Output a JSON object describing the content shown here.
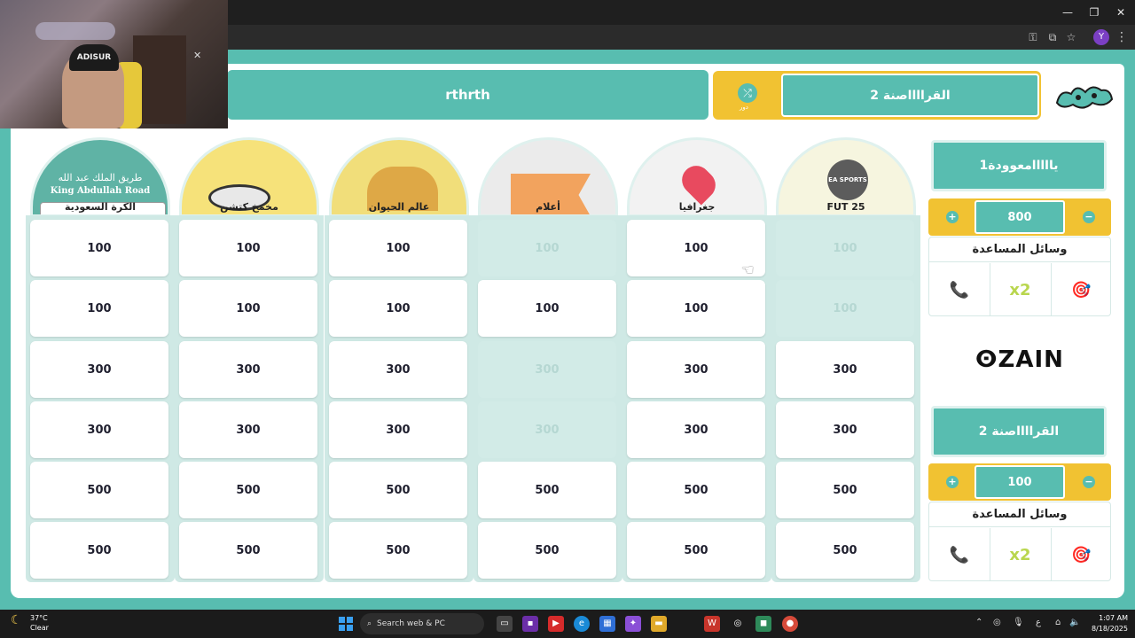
{
  "window": {
    "minimize": "—",
    "maximize": "❐",
    "close": "✕"
  },
  "browser": {
    "profile_initial": "Y",
    "menu": "⋮"
  },
  "webcam": {
    "hat_text": "ADISUR"
  },
  "header": {
    "team_left": "rthrth",
    "team_right": "القرااااصنة 2",
    "turn_label": "دور"
  },
  "categories": [
    {
      "label": "FUT 25",
      "badge": "EA SPORTS",
      "bg": "#f6f5df"
    },
    {
      "label": "جغرافيا",
      "bg": "#f2f2f2"
    },
    {
      "label": "أعلام",
      "bg": "#ebebeb"
    },
    {
      "label": "عالم الحيوان",
      "bg": "#f1de7a"
    },
    {
      "label": "مخمخ كتشن",
      "bg": "#f6e27a"
    },
    {
      "label": "الكرة السعودية",
      "sign_ar": "طريق الملك عبد الله",
      "sign_en": "King Abdullah Road",
      "bg": "#5fb3a5"
    }
  ],
  "grid": {
    "rows": [
      [
        "100",
        "100",
        "100",
        "100",
        "100",
        "100"
      ],
      [
        "100",
        "100",
        "100",
        "100",
        "100",
        "100"
      ],
      [
        "300",
        "300",
        "300",
        "300",
        "300",
        "300"
      ],
      [
        "300",
        "300",
        "300",
        "300",
        "300",
        "300"
      ],
      [
        "500",
        "500",
        "500",
        "500",
        "500",
        "500"
      ],
      [
        "500",
        "500",
        "500",
        "500",
        "500",
        "500"
      ]
    ],
    "used": [
      [
        true,
        false,
        true,
        false,
        false,
        false
      ],
      [
        true,
        false,
        false,
        false,
        false,
        false
      ],
      [
        false,
        false,
        true,
        false,
        false,
        false
      ],
      [
        false,
        false,
        true,
        false,
        false,
        false
      ],
      [
        false,
        false,
        false,
        false,
        false,
        false
      ],
      [
        false,
        false,
        false,
        false,
        false,
        false
      ]
    ]
  },
  "teams": [
    {
      "name": "يااااامعوودة1",
      "score": "800",
      "aids_title": "وسائل المساعدة",
      "aids": [
        "📞",
        "x2",
        "🎯"
      ]
    },
    {
      "name": "القرااااصنة 2",
      "score": "100",
      "aids_title": "وسائل المساعدة",
      "aids": [
        "📞",
        "x2",
        "🎯"
      ]
    }
  ],
  "sponsor": "ⵙZAIN",
  "taskbar": {
    "temp": "37°C",
    "condition": "Clear",
    "search_placeholder": "Search web & PC",
    "time": "1:07 AM",
    "date": "8/18/2025",
    "lang": "ع"
  },
  "colors": {
    "teal": "#58bdb0",
    "yellow": "#f1c232",
    "used": "#d2ebe7"
  }
}
